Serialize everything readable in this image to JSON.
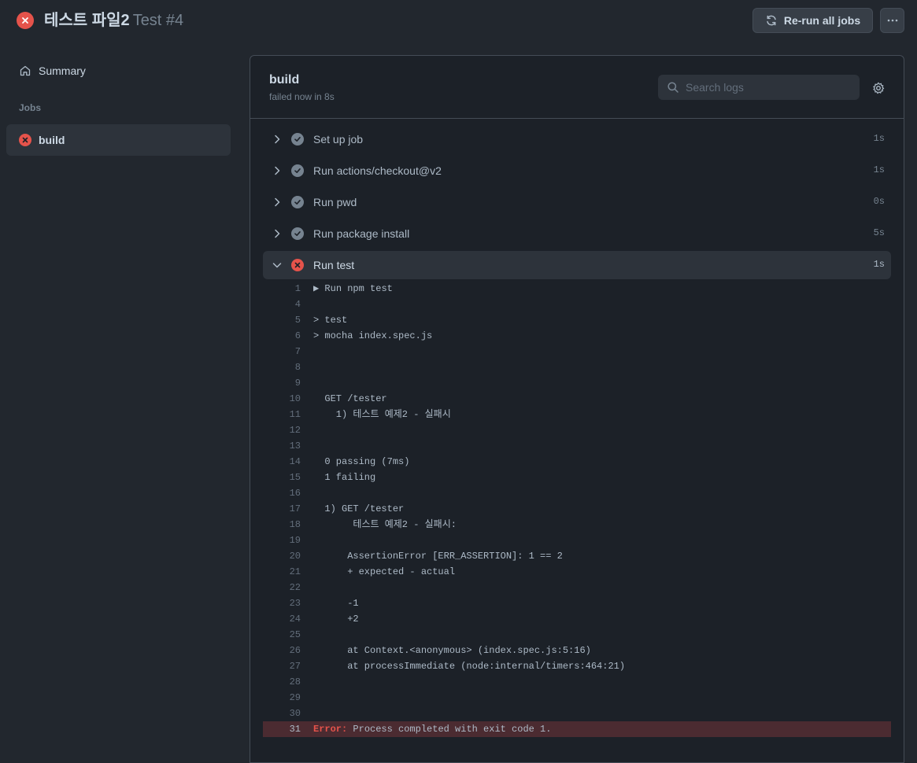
{
  "header": {
    "title": "테스트 파일2",
    "run_number": "Test #4",
    "rerun_label": "Re-run all jobs",
    "status_icon": "x-circle-fill-icon",
    "status_color": "#e5534b"
  },
  "sidebar": {
    "summary_label": "Summary",
    "jobs_label": "Jobs",
    "jobs": [
      {
        "label": "build",
        "status": "failed"
      }
    ]
  },
  "job": {
    "name": "build",
    "meta": "failed now in 8s",
    "search_placeholder": "Search logs",
    "steps": [
      {
        "label": "Set up job",
        "time": "1s",
        "status": "success"
      },
      {
        "label": "Run actions/checkout@v2",
        "time": "1s",
        "status": "success"
      },
      {
        "label": "Run pwd",
        "time": "0s",
        "status": "success"
      },
      {
        "label": "Run package install",
        "time": "5s",
        "status": "success"
      },
      {
        "label": "Run test",
        "time": "1s",
        "status": "failed",
        "expanded": true
      }
    ]
  },
  "log": {
    "lines": [
      {
        "n": "1",
        "t": "▶ Run npm test"
      },
      {
        "n": "4",
        "t": ""
      },
      {
        "n": "5",
        "t": "> test"
      },
      {
        "n": "6",
        "t": "> mocha index.spec.js"
      },
      {
        "n": "7",
        "t": ""
      },
      {
        "n": "8",
        "t": ""
      },
      {
        "n": "9",
        "t": ""
      },
      {
        "n": "10",
        "t": "  GET /tester"
      },
      {
        "n": "11",
        "t": "    1) 테스트 예제2 - 실패시"
      },
      {
        "n": "12",
        "t": ""
      },
      {
        "n": "13",
        "t": ""
      },
      {
        "n": "14",
        "t": "  0 passing (7ms)"
      },
      {
        "n": "15",
        "t": "  1 failing"
      },
      {
        "n": "16",
        "t": ""
      },
      {
        "n": "17",
        "t": "  1) GET /tester"
      },
      {
        "n": "18",
        "t": "       테스트 예제2 - 실패시:"
      },
      {
        "n": "19",
        "t": ""
      },
      {
        "n": "20",
        "t": "      AssertionError [ERR_ASSERTION]: 1 == 2"
      },
      {
        "n": "21",
        "t": "      + expected - actual"
      },
      {
        "n": "22",
        "t": ""
      },
      {
        "n": "23",
        "t": "      -1"
      },
      {
        "n": "24",
        "t": "      +2"
      },
      {
        "n": "25",
        "t": ""
      },
      {
        "n": "26",
        "t": "      at Context.<anonymous> (index.spec.js:5:16)"
      },
      {
        "n": "27",
        "t": "      at processImmediate (node:internal/timers:464:21)"
      },
      {
        "n": "28",
        "t": ""
      },
      {
        "n": "29",
        "t": ""
      },
      {
        "n": "30",
        "t": ""
      }
    ],
    "error_line": {
      "n": "31",
      "key": "Error:",
      "t": " Process completed with exit code 1."
    }
  }
}
